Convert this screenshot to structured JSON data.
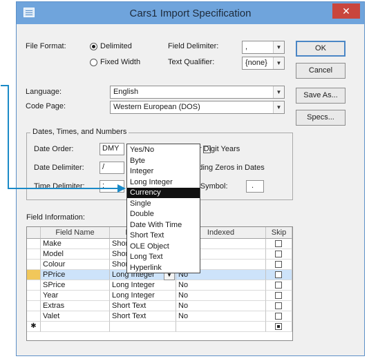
{
  "window": {
    "title": "Cars1 Import Specification",
    "close_glyph": "✕"
  },
  "file_format": {
    "label": "File Format:",
    "options": [
      {
        "label": "Delimited",
        "selected": true
      },
      {
        "label": "Fixed Width",
        "selected": false
      }
    ]
  },
  "field_delimiter": {
    "label": "Field Delimiter:",
    "value": ","
  },
  "text_qualifier": {
    "label": "Text Qualifier:",
    "value": "{none}"
  },
  "language": {
    "label": "Language:",
    "value": "English"
  },
  "code_page": {
    "label": "Code Page:",
    "value": "Western European (DOS)"
  },
  "buttons": {
    "ok": "OK",
    "cancel": "Cancel",
    "save_as": "Save As...",
    "specs": "Specs..."
  },
  "dates_group": {
    "title": "Dates, Times, and Numbers",
    "date_order_label": "Date Order:",
    "date_order_value": "DMY",
    "date_delimiter_label": "Date Delimiter:",
    "date_delimiter_value": "/",
    "time_delimiter_label": "Time Delimiter:",
    "time_delimiter_value": ":",
    "four_digit_years_label": "Four Digit Years",
    "leading_zeros_label": "Leading Zeros in Dates",
    "decimal_symbol_label": "mal Symbol:",
    "decimal_symbol_value": "."
  },
  "field_info": {
    "label": "Field Information:",
    "headers": [
      "Field Name",
      "Data Type",
      "Indexed",
      "Skip"
    ],
    "rows": [
      {
        "name": "Make",
        "type": "Short Text",
        "indexed": "No"
      },
      {
        "name": "Model",
        "type": "Short Text",
        "indexed": "No"
      },
      {
        "name": "Colour",
        "type": "Short Text",
        "indexed": "No"
      },
      {
        "name": "PPrice",
        "type": "Long Integer",
        "indexed": "No",
        "selected": true
      },
      {
        "name": "SPrice",
        "type": "Long Integer",
        "indexed": "No"
      },
      {
        "name": "Year",
        "type": "Long Integer",
        "indexed": "No"
      },
      {
        "name": "Extras",
        "type": "Short Text",
        "indexed": "No"
      },
      {
        "name": "Valet",
        "type": "Short Text",
        "indexed": "No"
      }
    ],
    "new_row_marker": "✱"
  },
  "data_type_dropdown": {
    "options": [
      "Yes/No",
      "Byte",
      "Integer",
      "Long Integer",
      "Currency",
      "Single",
      "Double",
      "Date With Time",
      "Short Text",
      "OLE Object",
      "Long Text",
      "Hyperlink"
    ],
    "highlighted": "Currency"
  },
  "colors": {
    "titlebar": "#6fa4dc",
    "arrow": "#1a8ac7",
    "highlight": "#111111",
    "selected_row": "#cde3fa",
    "row_marker": "#f1c75a"
  }
}
